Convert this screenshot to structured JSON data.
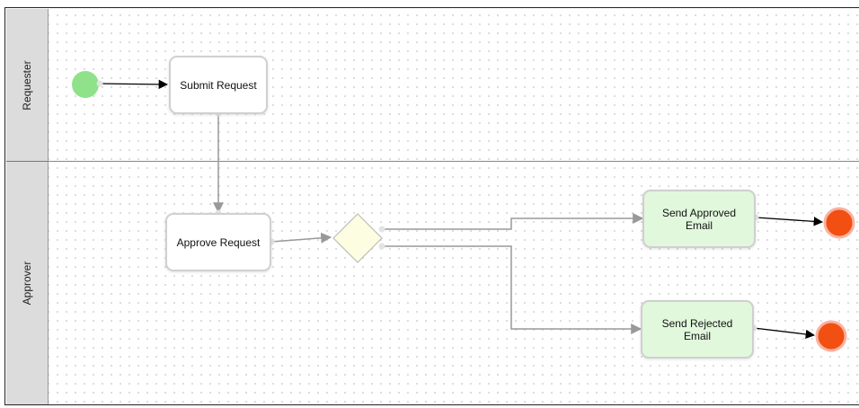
{
  "diagram": {
    "lanes": [
      {
        "id": "requester",
        "label": "Requester"
      },
      {
        "id": "approver",
        "label": "Approver"
      }
    ],
    "nodes": [
      {
        "id": "start",
        "kind": "start-event",
        "color": "#90e28a"
      },
      {
        "id": "submit",
        "kind": "task",
        "label": "Submit Request"
      },
      {
        "id": "approve",
        "kind": "task",
        "label": "Approve Request"
      },
      {
        "id": "gateway",
        "kind": "exclusive-gateway",
        "color": "#fdfde1"
      },
      {
        "id": "sendApproved",
        "kind": "task",
        "label": "Send Approved\nEmail",
        "color": "#e1f8dc"
      },
      {
        "id": "sendRejected",
        "kind": "task",
        "label": "Send Rejected\nEmail",
        "color": "#e1f8dc"
      },
      {
        "id": "endApproved",
        "kind": "end-event",
        "color": "#f24f12"
      },
      {
        "id": "endRejected",
        "kind": "end-event",
        "color": "#f24f12"
      }
    ],
    "edges": [
      {
        "from": "start",
        "to": "submit"
      },
      {
        "from": "submit",
        "to": "approve"
      },
      {
        "from": "approve",
        "to": "gateway"
      },
      {
        "from": "gateway",
        "to": "sendApproved"
      },
      {
        "from": "gateway",
        "to": "sendRejected"
      },
      {
        "from": "sendApproved",
        "to": "endApproved"
      },
      {
        "from": "sendRejected",
        "to": "endRejected"
      }
    ]
  }
}
